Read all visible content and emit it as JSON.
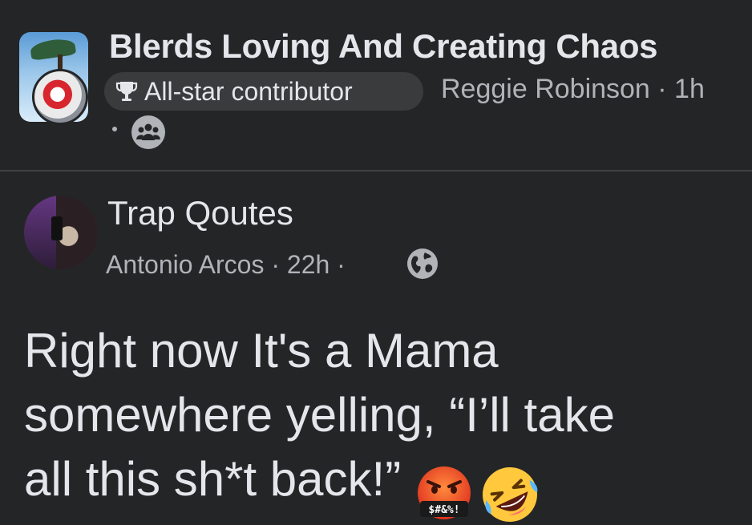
{
  "group": {
    "name": "Blerds Loving And Creating Chaos",
    "badge_label": "All-star contributor",
    "poster_line": "Reggie Robinson · 1h",
    "privacy_icon": "group-members-icon"
  },
  "shared_post": {
    "page_name": "Trap Qoutes",
    "meta_line": "Antonio Arcos · 22h ·",
    "privacy_icon": "globe-icon",
    "text_lines": [
      "Right now It's a Mama",
      "somewhere yelling, “I’ll take",
      "all this sh*t back!”"
    ],
    "emoji_1": "cursing-face-emoji",
    "emoji_1_text": "$#&%!",
    "emoji_2": "rolling-laughing-emoji"
  },
  "colors": {
    "background": "#242526",
    "primary_text": "#e4e6eb",
    "secondary_text": "#b0b3b8",
    "badge_bg": "#3a3b3c"
  }
}
